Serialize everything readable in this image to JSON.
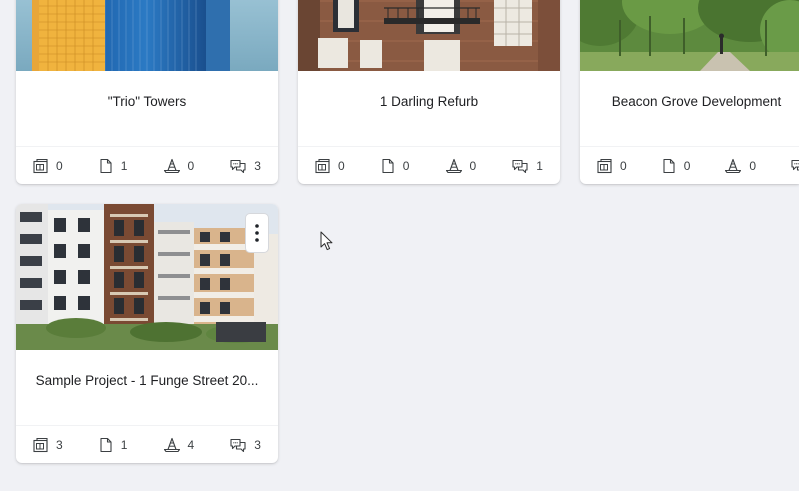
{
  "projects": [
    {
      "title": "\"Trio\" Towers",
      "stats": {
        "drawings": "0",
        "documents": "1",
        "issues": "0",
        "comments": "3"
      }
    },
    {
      "title": "1 Darling Refurb",
      "stats": {
        "drawings": "0",
        "documents": "0",
        "issues": "0",
        "comments": "1"
      }
    },
    {
      "title": "Beacon Grove Development",
      "stats": {
        "drawings": "0",
        "documents": "0",
        "issues": "0"
      }
    },
    {
      "title": "Sample Project - 1 Funge Street 20...",
      "stats": {
        "drawings": "3",
        "documents": "1",
        "issues": "4",
        "comments": "3"
      }
    }
  ],
  "icons": {
    "stat_1": "building-plan-icon",
    "stat_2": "document-icon",
    "stat_3": "traffic-cone-icon",
    "stat_4": "chat-bubbles-icon",
    "menu": "vertical-dots-icon",
    "pointer": "mouse-cursor-icon"
  },
  "colors": {
    "background": "#f0f1f5",
    "card": "#ffffff",
    "icon": "#3c4043"
  }
}
